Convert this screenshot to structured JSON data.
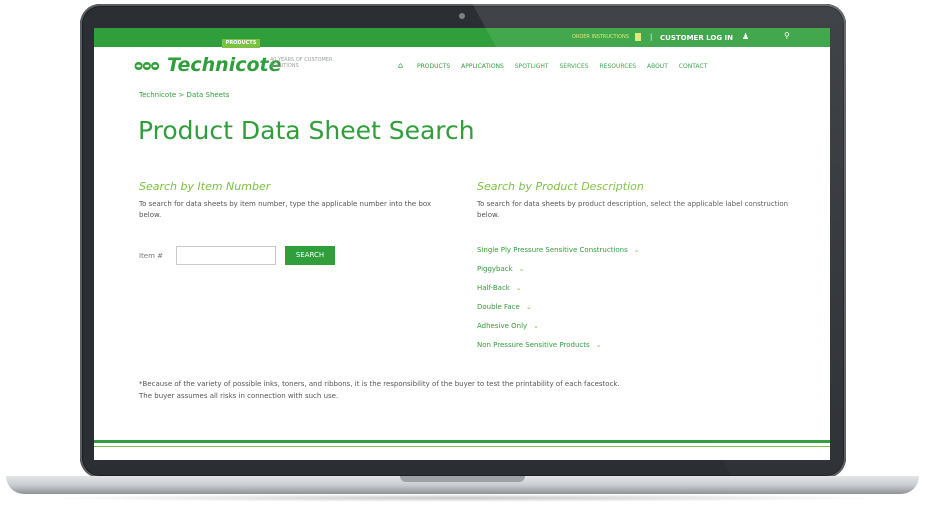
{
  "topbar": {
    "icon_link_label": "ORDER INSTRUCTIONS",
    "customer_login": "CUSTOMER LOG IN"
  },
  "header": {
    "logo_mark": "ᴑᴑᴑ",
    "logo_text": "Technicote",
    "tagline": "40 YEARS OF CUSTOMER SOLUTIONS",
    "highlight_tab": "PRODUCTS",
    "nav": [
      "PRODUCTS",
      "APPLICATIONS",
      "SPOTLIGHT",
      "SERVICES",
      "RESOURCES",
      "ABOUT",
      "CONTACT"
    ]
  },
  "breadcrumb": "Technicote  >  Data Sheets",
  "page_title": "Product Data Sheet Search",
  "left": {
    "heading": "Search by Item Number",
    "text": "To search for data sheets by item number, type the applicable number into the box below.",
    "item_label": "Item #",
    "input_value": "",
    "search_button": "SEARCH"
  },
  "right": {
    "heading": "Search by Product Description",
    "text": "To search for data sheets by product description, select the applicable label construction below.",
    "items": [
      "Single Ply Pressure Sensitive Constructions",
      "Piggyback",
      "Half-Back",
      "Double Face",
      "Adhesive Only",
      "Non Pressure Sensitive Products"
    ]
  },
  "disclaimer": {
    "line1": "*Because of the variety of possible inks, toners, and ribbons, it is the responsibility of the buyer to test the printability of each facestock.",
    "line2": "The buyer assumes all risks in connection with such use."
  },
  "colors": {
    "brand_green": "#2f9e3b",
    "accent_green": "#7cc142"
  }
}
